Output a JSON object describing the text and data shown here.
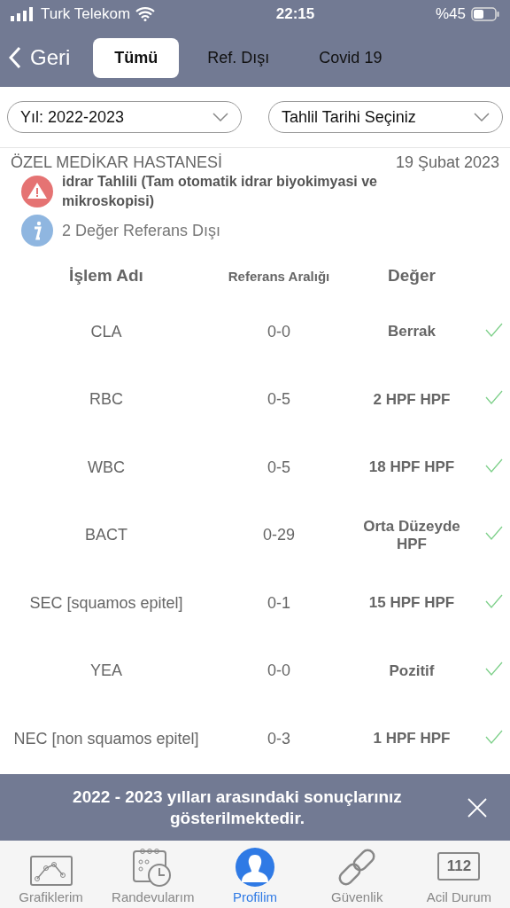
{
  "status_bar": {
    "carrier": "Turk Telekom",
    "time": "22:15",
    "battery": "%45"
  },
  "nav": {
    "back": "Geri",
    "tabs": [
      {
        "label": "Tümü",
        "selected": true
      },
      {
        "label": "Ref. Dışı",
        "selected": false
      },
      {
        "label": "Covid 19",
        "selected": false
      }
    ]
  },
  "filters": [
    {
      "value": "Yıl: 2022-2023"
    },
    {
      "value": "Tahlil Tarihi Seçiniz"
    }
  ],
  "report": {
    "hospital": "ÖZEL MEDİKAR HASTANESİ",
    "date": "19 Şubat 2023",
    "test_name": "idrar Tahlili (Tam otomatik idrar biyokimyasi ve mikroskopisi)",
    "info": "2 Değer Referans Dışı"
  },
  "table": {
    "columns": [
      "İşlem Adı",
      "Referans Aralığı",
      "Değer"
    ],
    "rows": [
      {
        "name": "CLA",
        "range": "0-0",
        "value": "Berrak",
        "ok": true
      },
      {
        "name": "RBC",
        "range": "0-5",
        "value": "2 HPF HPF",
        "ok": true
      },
      {
        "name": "WBC",
        "range": "0-5",
        "value": "18 HPF HPF",
        "ok": true
      },
      {
        "name": "BACT",
        "range": "0-29",
        "value": "Orta Düzeyde HPF",
        "ok": true
      },
      {
        "name": "SEC [squamos epitel]",
        "range": "0-1",
        "value": "15 HPF HPF",
        "ok": true
      },
      {
        "name": "YEA",
        "range": "0-0",
        "value": "Pozitif",
        "ok": true
      },
      {
        "name": "NEC [non squamos epitel]",
        "range": "0-3",
        "value": "1 HPF HPF",
        "ok": true
      }
    ]
  },
  "banner": {
    "message": "2022 - 2023 yılları arasındaki sonuçlarınız gösterilmektedir."
  },
  "tab_bar": [
    {
      "kind": "chart",
      "label": "Grafiklerim",
      "selected": false
    },
    {
      "kind": "calendar",
      "label": "Randevularım",
      "selected": false
    },
    {
      "kind": "profile",
      "label": "Profilim",
      "selected": true
    },
    {
      "kind": "link",
      "label": "Güvenlik",
      "selected": false
    },
    {
      "kind": "emergency",
      "label": "Acil Durum",
      "icon_text": "112",
      "selected": false
    }
  ]
}
